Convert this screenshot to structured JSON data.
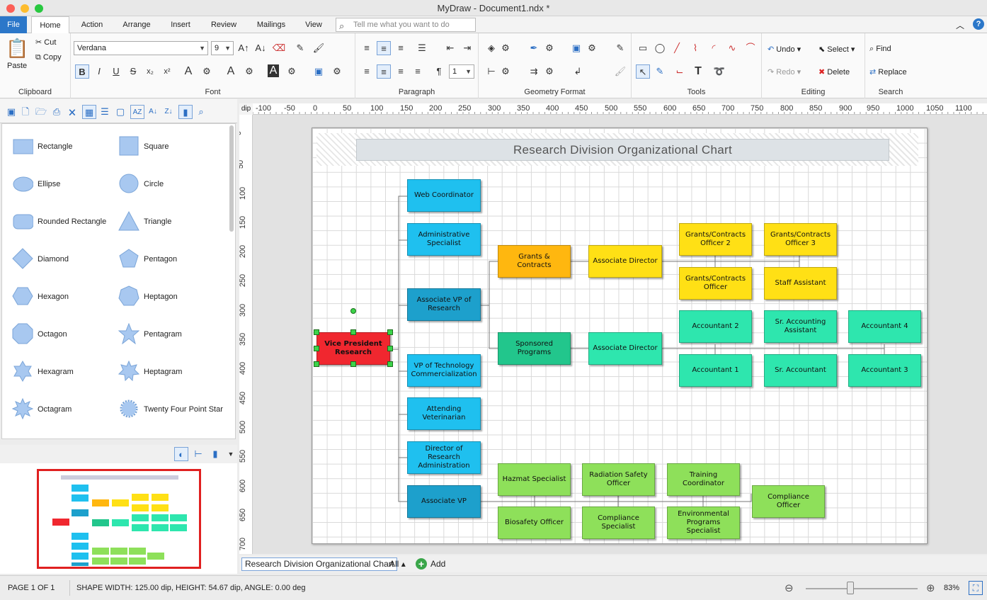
{
  "window": {
    "title": "MyDraw - Document1.ndx *"
  },
  "tabs": [
    "File",
    "Home",
    "Action",
    "Arrange",
    "Insert",
    "Review",
    "Mailings",
    "View"
  ],
  "tell_me": {
    "placeholder": "Tell me what you want to do"
  },
  "ribbon": {
    "clipboard": {
      "label": "Clipboard",
      "paste": "Paste",
      "cut": "Cut",
      "copy": "Copy"
    },
    "font": {
      "label": "Font",
      "family": "Verdana",
      "size": "9"
    },
    "paragraph": {
      "label": "Paragraph",
      "spacing": "1"
    },
    "geometry": {
      "label": "Geometry Format"
    },
    "tools": {
      "label": "Tools"
    },
    "editing": {
      "label": "Editing",
      "undo": "Undo",
      "redo": "Redo",
      "select": "Select",
      "delete": "Delete"
    },
    "search": {
      "label": "Search",
      "find": "Find",
      "replace": "Replace"
    }
  },
  "shapes": [
    {
      "name": "Rectangle",
      "icon": "rectangle-icon"
    },
    {
      "name": "Square",
      "icon": "square-icon"
    },
    {
      "name": "Ellipse",
      "icon": "ellipse-icon"
    },
    {
      "name": "Circle",
      "icon": "circle-icon"
    },
    {
      "name": "Rounded Rectangle",
      "icon": "rounded-rectangle-icon"
    },
    {
      "name": "Triangle",
      "icon": "triangle-icon"
    },
    {
      "name": "Diamond",
      "icon": "diamond-icon"
    },
    {
      "name": "Pentagon",
      "icon": "pentagon-icon"
    },
    {
      "name": "Hexagon",
      "icon": "hexagon-icon"
    },
    {
      "name": "Heptagon",
      "icon": "heptagon-icon"
    },
    {
      "name": "Octagon",
      "icon": "octagon-icon"
    },
    {
      "name": "Pentagram",
      "icon": "pentagram-icon"
    },
    {
      "name": "Hexagram",
      "icon": "hexagram-icon"
    },
    {
      "name": "Heptagram",
      "icon": "heptagram-icon"
    },
    {
      "name": "Octagram",
      "icon": "octagram-icon"
    },
    {
      "name": "Twenty Four Point Star",
      "icon": "star24-icon"
    }
  ],
  "ruler": {
    "unit": "dip",
    "h": [
      "-100",
      "-50",
      "0",
      "50",
      "100",
      "150",
      "200",
      "250",
      "300",
      "350",
      "400",
      "450",
      "500",
      "550",
      "600",
      "650",
      "700",
      "750",
      "800",
      "850",
      "900",
      "950",
      "1000",
      "1050",
      "1100"
    ],
    "v": [
      "0",
      "50",
      "100",
      "150",
      "200",
      "250",
      "300",
      "350",
      "400",
      "450",
      "500",
      "550",
      "600",
      "650",
      "700"
    ]
  },
  "diagram": {
    "title": "Research Division Organizational Chart",
    "nodes": {
      "vp": "Vice President Research",
      "web": "Web Coordinator",
      "admin": "Administrative Specialist",
      "assoc_vp_research": "Associate VP of Research",
      "vp_tech": "VP of Technology Commercialization",
      "att_vet": "Attending Veterinarian",
      "dir_research": "Director of Research Administration",
      "assoc_vp": "Associate VP",
      "grants": "Grants & Contracts",
      "sponsored": "Sponsored Programs",
      "assoc_dir1": "Associate Director",
      "assoc_dir2": "Associate Director",
      "gco2": "Grants/Contracts Officer 2",
      "gco3": "Grants/Contracts Officer 3",
      "gco": "Grants/Contracts Officer",
      "staff": "Staff Assistant",
      "acc2": "Accountant 2",
      "sr_acc_asst": "Sr. Accounting Assistant",
      "acc4": "Accountant 4",
      "acc1": "Accountant 1",
      "sr_acc": "Sr. Accountant",
      "acc3": "Accountant 3",
      "hazmat": "Hazmat Specialist",
      "radiation": "Radiation Safety Officer",
      "training": "Training Coordinator",
      "compliance_off": "Compliance Officer",
      "biosafety": "Biosafety Officer",
      "compliance_spec": "Compliance Specialist",
      "env": "Environmental Programs Specialist"
    }
  },
  "pages_bar": {
    "page_tab": "Research Division Organizational Chart",
    "all": "All",
    "add": "Add"
  },
  "status": {
    "page": "PAGE 1 OF 1",
    "shape": "SHAPE WIDTH: 125.00 dip, HEIGHT: 54.67 dip, ANGLE: 0.00 deg",
    "zoom": "83%"
  }
}
